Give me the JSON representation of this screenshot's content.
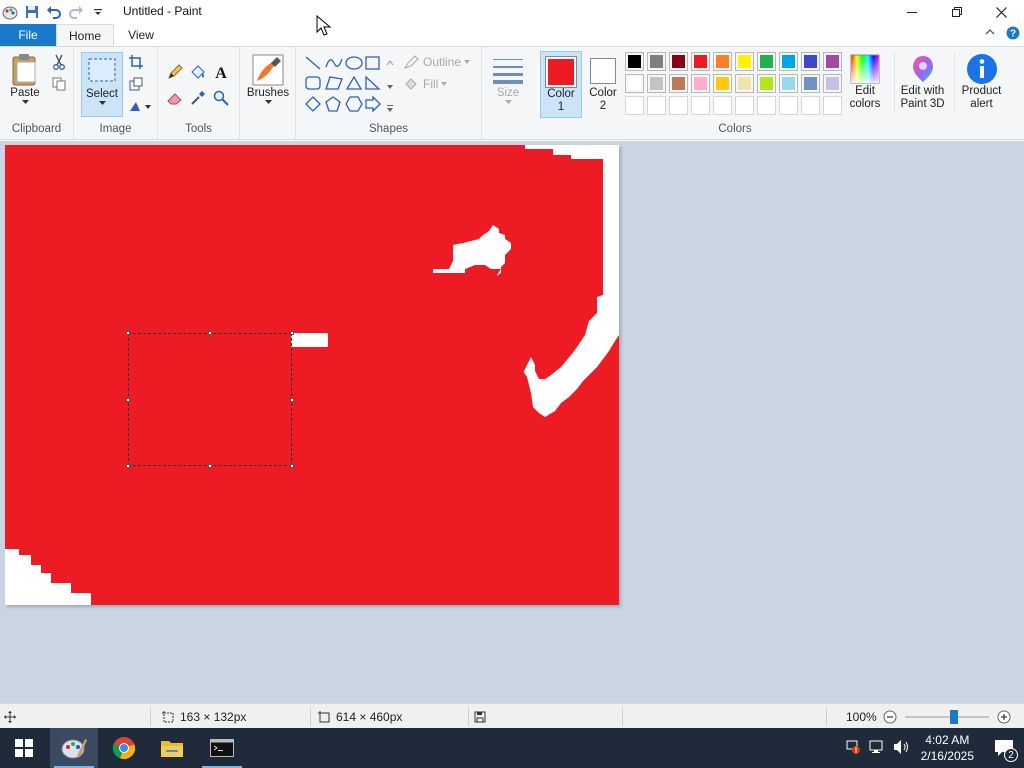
{
  "window": {
    "title": "Untitled - Paint"
  },
  "tabs": {
    "file": "File",
    "home": "Home",
    "view": "View"
  },
  "ribbon": {
    "clipboard": {
      "label": "Clipboard",
      "paste": "Paste"
    },
    "image": {
      "label": "Image",
      "select": "Select"
    },
    "tools": {
      "label": "Tools"
    },
    "brushes": {
      "label": "Brushes"
    },
    "shapes": {
      "label": "Shapes",
      "outline": "Outline",
      "fill": "Fill"
    },
    "size": {
      "label": "Size"
    },
    "color1": {
      "label_line1": "Color",
      "label_line2": "1",
      "value": "#ed1c24"
    },
    "color2": {
      "label_line1": "Color",
      "label_line2": "2",
      "value": "#ffffff"
    },
    "colors": {
      "label": "Colors",
      "row1": [
        "#000000",
        "#7f7f7f",
        "#880015",
        "#ed1c24",
        "#ff7f27",
        "#fff200",
        "#22b14c",
        "#00a2e8",
        "#3f48cc",
        "#a349a4"
      ],
      "row2": [
        "#ffffff",
        "#c3c3c3",
        "#b97a57",
        "#ffaec9",
        "#ffc90e",
        "#efe4b0",
        "#b5e61d",
        "#99d9ea",
        "#7092be",
        "#c8bfe7"
      ],
      "row3": [
        "#ffffff",
        "#ffffff",
        "#ffffff",
        "#ffffff",
        "#ffffff",
        "#ffffff",
        "#ffffff",
        "#ffffff",
        "#ffffff",
        "#ffffff"
      ]
    },
    "edit_colors": {
      "line1": "Edit",
      "line2": "colors"
    },
    "paint3d": {
      "line1": "Edit with",
      "line2": "Paint 3D"
    },
    "product_alert": {
      "line1": "Product",
      "line2": "alert"
    }
  },
  "canvas": {
    "fill_color": "#ed1c24",
    "background": "#ffffff"
  },
  "status": {
    "selection_size": "163 × 132px",
    "image_size": "614 × 460px",
    "zoom": "100%",
    "zoom_level": 0.6
  },
  "taskbar": {
    "time": "4:02 AM",
    "date": "2/16/2025",
    "notifications": "2"
  }
}
